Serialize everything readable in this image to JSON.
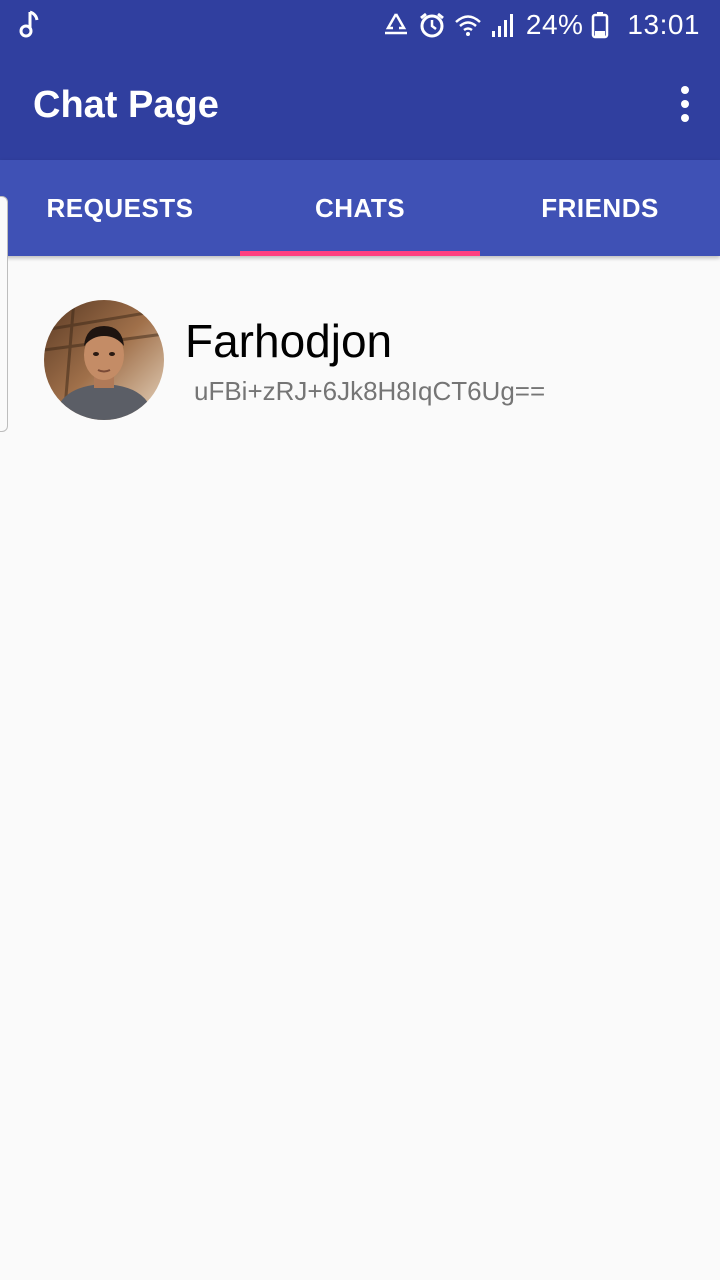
{
  "status_bar": {
    "left_icon": "music-note-icon",
    "icons": [
      "recycle-icon",
      "alarm-icon",
      "wifi-icon",
      "signal-icon"
    ],
    "battery_percent": "24%",
    "time": "13:01"
  },
  "app_bar": {
    "title": "Chat Page",
    "menu_icon": "overflow-menu-icon"
  },
  "tabs": [
    {
      "label": "REQUESTS",
      "active": false
    },
    {
      "label": "CHATS",
      "active": true
    },
    {
      "label": "FRIENDS",
      "active": false
    }
  ],
  "chats": [
    {
      "name": "Farhodjon",
      "preview": "uFBi+zRJ+6Jk8H8IqCT6Ug==",
      "avatar": "profile-photo"
    }
  ],
  "colors": {
    "primary_dark": "#303f9f",
    "primary": "#3f51b5",
    "accent": "#ff4081",
    "background": "#fafafa"
  }
}
